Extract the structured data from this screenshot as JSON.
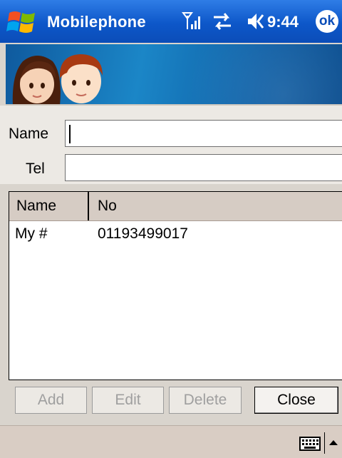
{
  "titlebar": {
    "app_title": "Mobilephone",
    "time": "9:44",
    "ok_label": "ok",
    "icons": [
      "windows-start-icon",
      "signal-icon",
      "sync-icon",
      "volume-icon"
    ]
  },
  "form": {
    "name_label": "Name",
    "tel_label": "Tel",
    "name_value": "",
    "tel_value": ""
  },
  "list": {
    "columns": [
      "Name",
      "No"
    ],
    "rows": [
      {
        "name": "My #",
        "no": "01193499017"
      }
    ]
  },
  "buttons": {
    "add": "Add",
    "edit": "Edit",
    "delete": "Delete",
    "close": "Close"
  },
  "colors": {
    "titlebar": "#0d57c9",
    "banner": "#1b86c7",
    "disabled_text": "#9f9f9f",
    "header_bg": "#d6ccc4"
  }
}
